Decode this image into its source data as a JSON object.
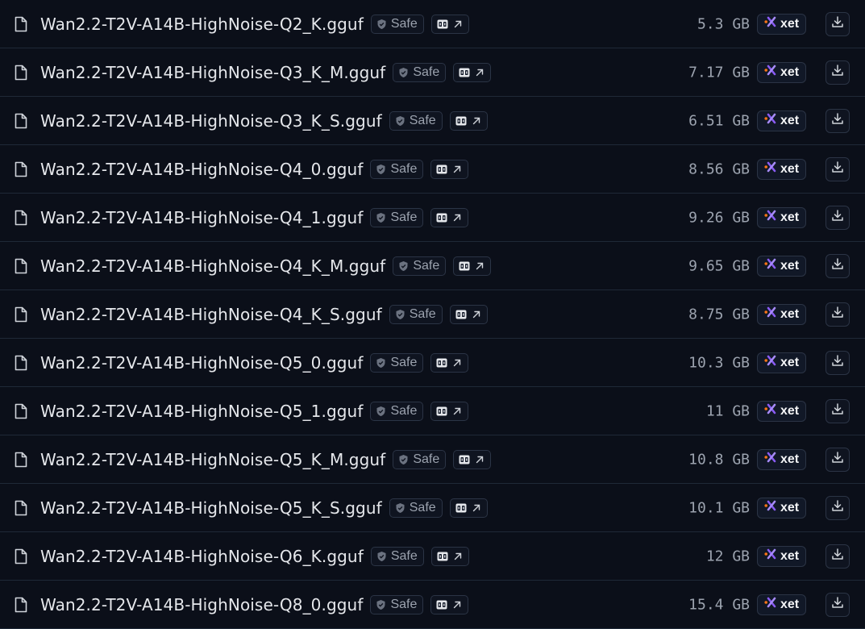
{
  "files": [
    {
      "name": "Wan2.2-T2V-A14B-HighNoise-Q2_K.gguf",
      "safe_label": "Safe",
      "size": "5.3 GB",
      "storage_label": "xet"
    },
    {
      "name": "Wan2.2-T2V-A14B-HighNoise-Q3_K_M.gguf",
      "safe_label": "Safe",
      "size": "7.17 GB",
      "storage_label": "xet"
    },
    {
      "name": "Wan2.2-T2V-A14B-HighNoise-Q3_K_S.gguf",
      "safe_label": "Safe",
      "size": "6.51 GB",
      "storage_label": "xet"
    },
    {
      "name": "Wan2.2-T2V-A14B-HighNoise-Q4_0.gguf",
      "safe_label": "Safe",
      "size": "8.56 GB",
      "storage_label": "xet"
    },
    {
      "name": "Wan2.2-T2V-A14B-HighNoise-Q4_1.gguf",
      "safe_label": "Safe",
      "size": "9.26 GB",
      "storage_label": "xet"
    },
    {
      "name": "Wan2.2-T2V-A14B-HighNoise-Q4_K_M.gguf",
      "safe_label": "Safe",
      "size": "9.65 GB",
      "storage_label": "xet"
    },
    {
      "name": "Wan2.2-T2V-A14B-HighNoise-Q4_K_S.gguf",
      "safe_label": "Safe",
      "size": "8.75 GB",
      "storage_label": "xet"
    },
    {
      "name": "Wan2.2-T2V-A14B-HighNoise-Q5_0.gguf",
      "safe_label": "Safe",
      "size": "10.3 GB",
      "storage_label": "xet"
    },
    {
      "name": "Wan2.2-T2V-A14B-HighNoise-Q5_1.gguf",
      "safe_label": "Safe",
      "size": "11 GB",
      "storage_label": "xet"
    },
    {
      "name": "Wan2.2-T2V-A14B-HighNoise-Q5_K_M.gguf",
      "safe_label": "Safe",
      "size": "10.8 GB",
      "storage_label": "xet"
    },
    {
      "name": "Wan2.2-T2V-A14B-HighNoise-Q5_K_S.gguf",
      "safe_label": "Safe",
      "size": "10.1 GB",
      "storage_label": "xet"
    },
    {
      "name": "Wan2.2-T2V-A14B-HighNoise-Q6_K.gguf",
      "safe_label": "Safe",
      "size": "12 GB",
      "storage_label": "xet"
    },
    {
      "name": "Wan2.2-T2V-A14B-HighNoise-Q8_0.gguf",
      "safe_label": "Safe",
      "size": "15.4 GB",
      "storage_label": "xet"
    }
  ],
  "icons": {
    "file": "file-icon",
    "safe": "shield-check-icon",
    "viewer": "gguf-viewer-icon",
    "external": "arrow-up-right-icon",
    "xet": "xet-logo-icon",
    "download": "download-icon"
  },
  "colors": {
    "background": "#0b0f19",
    "divider": "#1f2937",
    "text": "#e5e7eb",
    "muted": "#9ca3af",
    "xet_orange": "#f97316",
    "xet_purple": "#8b5cf6"
  }
}
